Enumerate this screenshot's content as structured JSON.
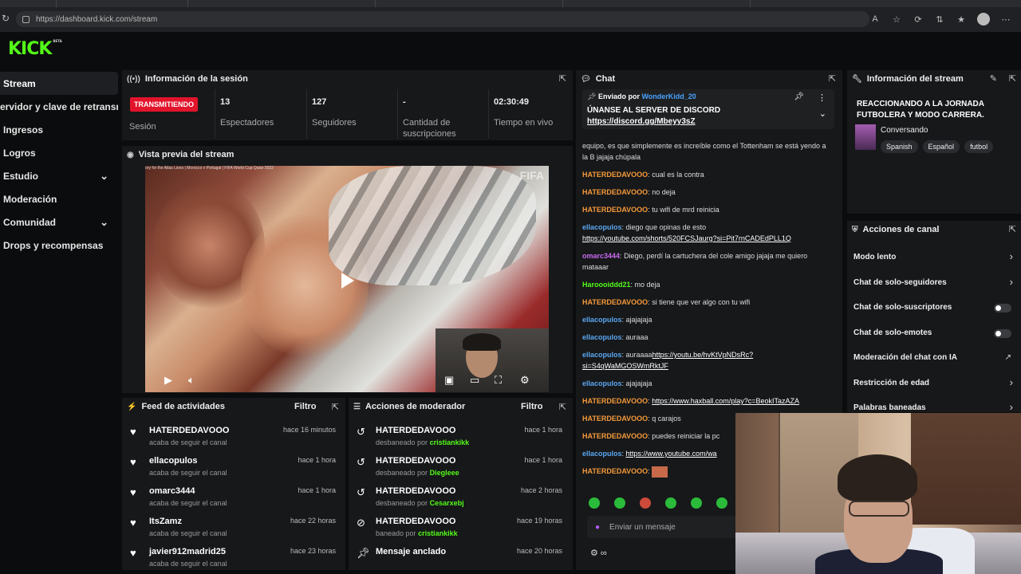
{
  "browser": {
    "url": "https://dashboard.kick.com/stream"
  },
  "brand": {
    "logo": "KICK",
    "badge": "BETA",
    "accent": "#53fc18"
  },
  "sidebar": {
    "items": [
      {
        "label": "Stream"
      },
      {
        "label": "ervidor y clave de retransm"
      },
      {
        "label": "Ingresos"
      },
      {
        "label": "Logros"
      },
      {
        "label": "Estudio"
      },
      {
        "label": "Moderación"
      },
      {
        "label": "Comunidad"
      },
      {
        "label": "Drops y recompensas"
      }
    ]
  },
  "session": {
    "title": "Información de la sesión",
    "status_badge": "TRANSMITIENDO",
    "status_label": "Sesión",
    "stats": [
      {
        "value": "13",
        "label": "Espectadores"
      },
      {
        "value": "127",
        "label": "Seguidores"
      },
      {
        "value": "-",
        "label": "Cantidad de suscripciones"
      },
      {
        "value": "02:30:49",
        "label": "Tiempo en vivo"
      }
    ]
  },
  "preview": {
    "title": "Vista previa del stream",
    "caption": "ory for the Atlas Lions | Morocco v Portugal | FIFA World Cup Qatar 2022",
    "watermark": "FIFA"
  },
  "activity_feed": {
    "title": "Feed de actividades",
    "filter": "Filtro",
    "rows": [
      {
        "user": "HATERDEDAVOOO",
        "desc": "acaba de seguir el canal",
        "time": "hace 16 minutos"
      },
      {
        "user": "ellacopulos",
        "desc": "acaba de seguir el canal",
        "time": "hace 1 hora"
      },
      {
        "user": "omarc3444",
        "desc": "acaba de seguir el canal",
        "time": "hace 1 hora"
      },
      {
        "user": "ItsZamz",
        "desc": "acaba de seguir el canal",
        "time": "hace 22 horas"
      },
      {
        "user": "javier912madrid25",
        "desc": "acaba de seguir el canal",
        "time": "hace 23 horas"
      }
    ]
  },
  "mod_actions": {
    "title": "Acciones de moderador",
    "filter": "Filtro",
    "rows": [
      {
        "user": "HATERDEDAVOOO",
        "action": "desbaneado por",
        "by": "cristiankikk",
        "time": "hace 1 hora"
      },
      {
        "user": "HATERDEDAVOOO",
        "action": "desbaneado por",
        "by": "Diegleee",
        "time": "hace 1 hora"
      },
      {
        "user": "HATERDEDAVOOO",
        "action": "desbaneado por",
        "by": "Cesarxebj",
        "time": "hace 2 horas"
      },
      {
        "user": "HATERDEDAVOOO",
        "action": "baneado por",
        "by": "cristiankikk",
        "time": "hace 19 horas"
      },
      {
        "user": "Mensaje anclado",
        "action": "",
        "by": "",
        "time": "hace 20 horas"
      }
    ]
  },
  "chat": {
    "title": "Chat",
    "pinned": {
      "sent_by": "Enviado por",
      "author": "WonderKidd_20",
      "message": "ÚNANSE AL SERVER DE DISCORD",
      "link": "https://discord.gg/Mbeyy3sZ"
    },
    "partial_top": "equipo, es que simplemente es increíble como el Tottenham se está yendo a la B jajaja chúpala",
    "messages": [
      {
        "user": "HATERDEDAVOOO",
        "color": "#f59a3a",
        "text": "cual es la contra",
        "link": ""
      },
      {
        "user": "HATERDEDAVOOO",
        "color": "#f59a3a",
        "text": "no deja",
        "link": ""
      },
      {
        "user": "HATERDEDAVOOO",
        "color": "#f59a3a",
        "text": "tu wifi de mrd reinicia",
        "link": ""
      },
      {
        "user": "ellacopulos",
        "color": "#5aa7f0",
        "text": "diego que opinas de esto",
        "link": "https://youtube.com/shorts/520FCSJaurg?si=Pit7rnCADEdPLL1Q"
      },
      {
        "user": "omarc3444",
        "color": "#c86af0",
        "text": "Diego, perdí la cartuchera del cole amigo jajaja me quiero mataaar",
        "link": ""
      },
      {
        "user": "Haroooiddd21",
        "color": "#53fc18",
        "text": "mo deja",
        "link": ""
      },
      {
        "user": "HATERDEDAVOOO",
        "color": "#f59a3a",
        "text": "si tiene que ver algo con tu wifi",
        "link": ""
      },
      {
        "user": "ellacopulos",
        "color": "#5aa7f0",
        "text": "ajajajaja",
        "link": ""
      },
      {
        "user": "ellacopulos",
        "color": "#5aa7f0",
        "text": "auraaa",
        "link": ""
      },
      {
        "user": "ellacopulos",
        "color": "#5aa7f0",
        "text": "auraaaa",
        "link": "https://youtu.be/hvKtVpNDsRc?si=S4qWaMGOSWmRktJF"
      },
      {
        "user": "ellacopulos",
        "color": "#5aa7f0",
        "text": "ajajajaja",
        "link": ""
      },
      {
        "user": "HATERDEDAVOOO",
        "color": "#f59a3a",
        "text": "",
        "link": "https://www.haxball.com/play?c=BeokITazAZA"
      },
      {
        "user": "HATERDEDAVOOO",
        "color": "#f59a3a",
        "text": "q carajos",
        "link": ""
      },
      {
        "user": "HATERDEDAVOOO",
        "color": "#f59a3a",
        "text": "puedes reiniciar la pc",
        "link": ""
      },
      {
        "user": "ellacopulos",
        "color": "#5aa7f0",
        "text": "",
        "link": "https://www.youtube.com/wa"
      },
      {
        "user": "HATERDEDAVOOO",
        "color": "#f59a3a",
        "text": "",
        "link": ""
      }
    ],
    "input_placeholder": "Enviar un mensaje"
  },
  "stream_info": {
    "title": "Información del stream",
    "stream_title": "REACCIONANDO A LA JORNADA FUTBOLERA Y MODO CARRERA.",
    "category": "Conversando",
    "tags": [
      "Spanish",
      "Español",
      "futbol"
    ]
  },
  "channel_actions": {
    "title": "Acciones de canal",
    "rows": [
      {
        "label": "Modo lento",
        "control": "arrow"
      },
      {
        "label": "Chat de solo-seguidores",
        "control": "arrow"
      },
      {
        "label": "Chat de solo-suscriptores",
        "control": "toggle"
      },
      {
        "label": "Chat de solo-emotes",
        "control": "toggle"
      },
      {
        "label": "Moderación del chat con IA",
        "control": "external"
      },
      {
        "label": "Restricción de edad",
        "control": "arrow"
      },
      {
        "label": "Palabras baneadas",
        "control": "arrow"
      }
    ]
  }
}
